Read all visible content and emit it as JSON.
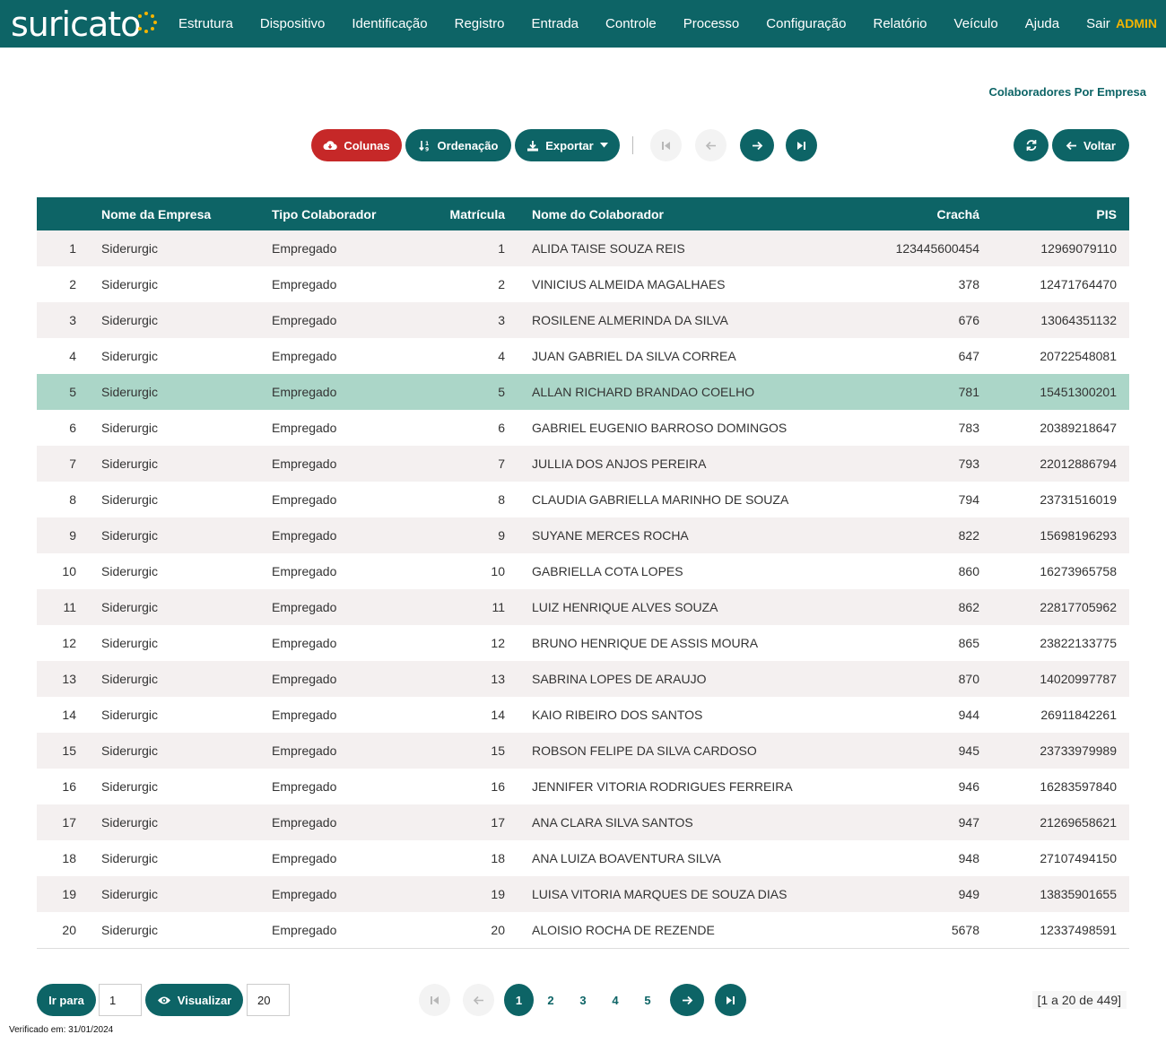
{
  "app": {
    "logo_text": "suricato",
    "user": "ADMIN"
  },
  "menu": [
    "Estrutura",
    "Dispositivo",
    "Identificação",
    "Registro",
    "Entrada",
    "Controle",
    "Processo",
    "Configuração",
    "Relatório",
    "Veículo",
    "Ajuda",
    "Sair"
  ],
  "page_title": "Colaboradores Por Empresa",
  "toolbar": {
    "columns_label": "Colunas",
    "order_label": "Ordenação",
    "export_label": "Exportar",
    "back_label": "Voltar"
  },
  "table": {
    "headers": [
      "",
      "Nome da Empresa",
      "Tipo Colaborador",
      "Matrícula",
      "Nome do Colaborador",
      "Crachá",
      "PIS"
    ],
    "selected_row": 5,
    "rows": [
      [
        "1",
        "Siderurgic",
        "Empregado",
        "1",
        "ALIDA TAISE SOUZA REIS",
        "123445600454",
        "12969079110"
      ],
      [
        "2",
        "Siderurgic",
        "Empregado",
        "2",
        "VINICIUS ALMEIDA MAGALHAES",
        "378",
        "12471764470"
      ],
      [
        "3",
        "Siderurgic",
        "Empregado",
        "3",
        "ROSILENE ALMERINDA DA SILVA",
        "676",
        "13064351132"
      ],
      [
        "4",
        "Siderurgic",
        "Empregado",
        "4",
        "JUAN GABRIEL DA SILVA CORREA",
        "647",
        "20722548081"
      ],
      [
        "5",
        "Siderurgic",
        "Empregado",
        "5",
        "ALLAN RICHARD BRANDAO COELHO",
        "781",
        "15451300201"
      ],
      [
        "6",
        "Siderurgic",
        "Empregado",
        "6",
        "GABRIEL EUGENIO BARROSO DOMINGOS",
        "783",
        "20389218647"
      ],
      [
        "7",
        "Siderurgic",
        "Empregado",
        "7",
        "JULLIA DOS ANJOS PEREIRA",
        "793",
        "22012886794"
      ],
      [
        "8",
        "Siderurgic",
        "Empregado",
        "8",
        "CLAUDIA GABRIELLA MARINHO DE SOUZA",
        "794",
        "23731516019"
      ],
      [
        "9",
        "Siderurgic",
        "Empregado",
        "9",
        "SUYANE MERCES ROCHA",
        "822",
        "15698196293"
      ],
      [
        "10",
        "Siderurgic",
        "Empregado",
        "10",
        "GABRIELLA COTA LOPES",
        "860",
        "16273965758"
      ],
      [
        "11",
        "Siderurgic",
        "Empregado",
        "11",
        "LUIZ HENRIQUE ALVES SOUZA",
        "862",
        "22817705962"
      ],
      [
        "12",
        "Siderurgic",
        "Empregado",
        "12",
        "BRUNO HENRIQUE DE ASSIS MOURA",
        "865",
        "23822133775"
      ],
      [
        "13",
        "Siderurgic",
        "Empregado",
        "13",
        "SABRINA LOPES DE ARAUJO",
        "870",
        "14020997787"
      ],
      [
        "14",
        "Siderurgic",
        "Empregado",
        "14",
        "KAIO RIBEIRO DOS SANTOS",
        "944",
        "26911842261"
      ],
      [
        "15",
        "Siderurgic",
        "Empregado",
        "15",
        "ROBSON FELIPE DA SILVA CARDOSO",
        "945",
        "23733979989"
      ],
      [
        "16",
        "Siderurgic",
        "Empregado",
        "16",
        "JENNIFER VITORIA RODRIGUES FERREIRA",
        "946",
        "16283597840"
      ],
      [
        "17",
        "Siderurgic",
        "Empregado",
        "17",
        "ANA CLARA SILVA SANTOS",
        "947",
        "21269658621"
      ],
      [
        "18",
        "Siderurgic",
        "Empregado",
        "18",
        "ANA LUIZA BOAVENTURA SILVA",
        "948",
        "27107494150"
      ],
      [
        "19",
        "Siderurgic",
        "Empregado",
        "19",
        "LUISA VITORIA MARQUES DE SOUZA DIAS",
        "949",
        "13835901655"
      ],
      [
        "20",
        "Siderurgic",
        "Empregado",
        "20",
        "ALOISIO ROCHA DE REZENDE",
        "5678",
        "12337498591"
      ]
    ]
  },
  "footer": {
    "goto_label": "Ir para",
    "goto_value": "1",
    "view_label": "Visualizar",
    "view_value": "20",
    "pages": [
      "1",
      "2",
      "3",
      "4",
      "5"
    ],
    "active_page": "1",
    "range_text": "[1 a 20 de 449]",
    "verified_text": "Verificado em: 31/01/2024"
  },
  "colors": {
    "primary": "#0d6466",
    "danger": "#c62828",
    "accent": "#f4b400",
    "row_selected": "#abd6c8",
    "row_stripe": "#f4f0f0"
  }
}
